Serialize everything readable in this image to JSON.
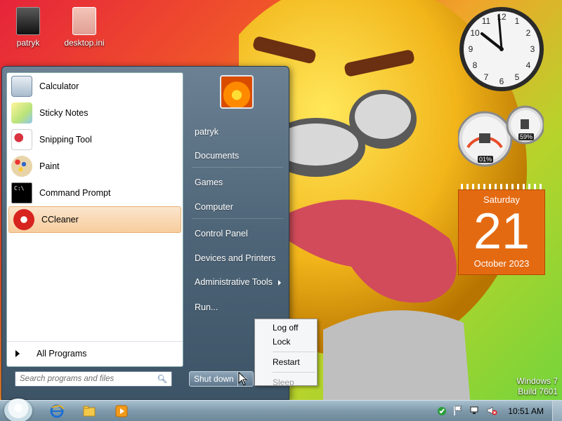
{
  "desktop": {
    "icons": [
      {
        "label": "patryk"
      },
      {
        "label": "desktop.ini"
      }
    ],
    "build_line1": "Windows 7",
    "build_line2": "Build 7601"
  },
  "gadgets": {
    "cpu_meter": {
      "cpu": "01%",
      "memory": "59%"
    },
    "calendar": {
      "weekday": "Saturday",
      "day": "21",
      "month_year": "October 2023"
    }
  },
  "start_menu": {
    "programs": [
      {
        "label": "Calculator",
        "icon": "calculator-icon"
      },
      {
        "label": "Sticky Notes",
        "icon": "sticky-notes-icon"
      },
      {
        "label": "Snipping Tool",
        "icon": "scissors-icon"
      },
      {
        "label": "Paint",
        "icon": "paint-palette-icon"
      },
      {
        "label": "Command Prompt",
        "icon": "terminal-icon"
      },
      {
        "label": "CCleaner",
        "icon": "ccleaner-icon"
      }
    ],
    "all_programs": "All Programs",
    "search_placeholder": "Search programs and files",
    "right_items": {
      "user": "patryk",
      "documents": "Documents",
      "games": "Games",
      "computer": "Computer",
      "control_panel": "Control Panel",
      "devices": "Devices and Printers",
      "admin_tools": "Administrative Tools",
      "run": "Run..."
    },
    "shutdown_label": "Shut down"
  },
  "power_menu": {
    "log_off": "Log off",
    "lock": "Lock",
    "restart": "Restart",
    "sleep": "Sleep"
  },
  "taskbar": {
    "time": "10:51 AM"
  },
  "colors": {
    "selected_item": "#f7cd9d",
    "calendar_orange": "#e46a12",
    "start_menu_glass": "#4e6578"
  }
}
